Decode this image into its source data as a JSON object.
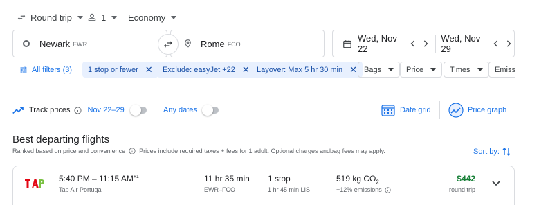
{
  "trip_bar": {
    "trip_type": "Round trip",
    "passengers": "1",
    "cabin": "Economy"
  },
  "search": {
    "origin_city": "Newark",
    "origin_code": "EWR",
    "destination_city": "Rome",
    "destination_code": "FCO",
    "depart_date": "Wed, Nov 22",
    "return_date": "Wed, Nov 29"
  },
  "filters": {
    "all_filters": "All filters (3)",
    "chips": [
      {
        "label": "1 stop or fewer"
      },
      {
        "label": "Exclude: easyJet +22"
      },
      {
        "label": "Layover: Max 5 hr 30 min"
      }
    ],
    "dropdowns": [
      {
        "label": "Bags"
      },
      {
        "label": "Price"
      },
      {
        "label": "Times"
      },
      {
        "label": "Emissions"
      }
    ]
  },
  "tracking": {
    "track_label": "Track prices",
    "date_range": "Nov 22–29",
    "any_dates": "Any dates",
    "date_grid": "Date grid",
    "price_graph": "Price graph"
  },
  "results": {
    "heading": "Best departing flights",
    "subtitle": "Ranked based on price and convenience",
    "notice_prefix": "Prices include required taxes + fees for 1 adult. Optional charges and ",
    "notice_link": "bag fees",
    "notice_suffix": " may apply.",
    "sort_label": "Sort by:"
  },
  "flights": [
    {
      "airline_logo": "TAP",
      "times": "5:40 PM – 11:15 AM",
      "day_offset": "+1",
      "airline": "Tap Air Portugal",
      "duration": "11 hr 35 min",
      "route": "EWR–FCO",
      "stops": "1 stop",
      "layover": "1 hr 45 min LIS",
      "emissions": "519 kg CO",
      "emissions_sub": "2",
      "emissions_delta": "+12% emissions",
      "price": "$442",
      "price_note": "round trip"
    }
  ],
  "colors": {
    "accent": "#1a73e8",
    "chip_bg": "#e8f0fe",
    "price_green": "#188038",
    "border": "#dadce0"
  }
}
